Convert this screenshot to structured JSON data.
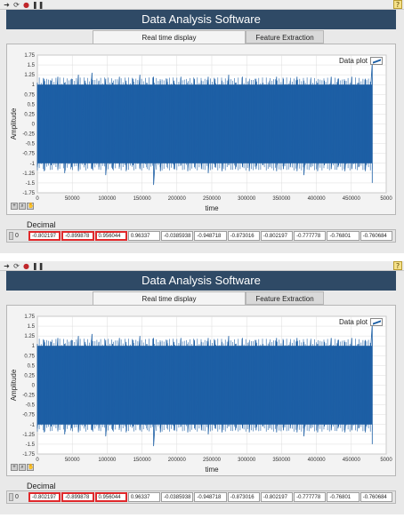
{
  "app_title": "Data Analysis Software",
  "tabs": [
    {
      "label": "Real time display",
      "active": true
    },
    {
      "label": "Feature Extraction",
      "active": false
    }
  ],
  "legend_label": "Data plot",
  "decimal_label": "Decimal",
  "index_value": "0",
  "decimal_values": [
    "-0.802197",
    "-0.899878",
    "0.956044",
    "0.96337",
    "-0.0385938",
    "-0.948718",
    "-0.873016",
    "-0.802197",
    "-0.777778",
    "-0.76801",
    "-0.760684"
  ],
  "highlighted_cells": [
    0,
    1,
    2
  ],
  "toolbar_icons": [
    "run-arrow-icon",
    "run-continuous-icon",
    "abort-icon",
    "pause-icon"
  ],
  "help_icon": "?",
  "colors": {
    "title_bg": "#2f4a66",
    "signal": "#1d5fa5",
    "highlight": "#e0282b",
    "plot_bg": "#ffffff",
    "grid": "#dcdcdc"
  },
  "chart_data": {
    "type": "line",
    "title": "",
    "xlabel": "time",
    "ylabel": "Amplitude",
    "xlim": [
      0,
      500000
    ],
    "ylim": [
      -1.75,
      1.75
    ],
    "x_ticks": [
      "0",
      "50000",
      "100000",
      "150000",
      "200000",
      "250000",
      "300000",
      "350000",
      "400000",
      "450000",
      "5000"
    ],
    "y_ticks": [
      "1.75",
      "1.5",
      "1.25",
      "1",
      "0.75",
      "0.5",
      "0.25",
      "0",
      "-0.25",
      "-0.5",
      "-0.75",
      "-1",
      "-1.25",
      "-1.5",
      "-1.75"
    ],
    "grid": true,
    "legend_position": "top-right",
    "series": [
      {
        "name": "Data plot",
        "x_end": 480000,
        "typical_range": [
          -1.0,
          1.0
        ],
        "envelope_top": [
          1.05,
          1.15,
          1.1,
          1.2,
          1.05,
          1.15,
          1.25,
          1.1,
          1.3,
          1.1,
          1.15,
          1.05,
          1.2,
          1.1,
          1.15,
          1.25,
          1.05,
          1.2,
          1.1,
          1.15,
          1.1,
          1.2,
          1.05,
          1.15,
          1.1,
          1.2,
          1.15,
          1.1,
          1.25,
          1.05,
          1.2,
          1.1,
          1.15,
          1.05,
          1.1,
          1.2,
          1.15,
          1.1,
          1.2,
          1.1,
          1.15,
          1.05,
          1.1,
          1.2,
          1.15,
          1.1,
          1.2,
          1.05,
          1.15,
          1.55
        ],
        "envelope_bottom": [
          -1.1,
          -1.2,
          -1.05,
          -1.15,
          -1.25,
          -1.1,
          -1.2,
          -1.05,
          -1.15,
          -1.1,
          -1.3,
          -1.15,
          -1.1,
          -1.2,
          -1.05,
          -1.15,
          -1.1,
          -1.55,
          -1.2,
          -1.1,
          -1.15,
          -1.05,
          -1.2,
          -1.1,
          -1.15,
          -1.25,
          -1.1,
          -1.2,
          -1.05,
          -1.15,
          -1.1,
          -1.2,
          -1.15,
          -1.05,
          -1.1,
          -1.2,
          -1.15,
          -1.1,
          -1.2,
          -1.3,
          -1.1,
          -1.2,
          -1.05,
          -1.15,
          -1.1,
          -1.2,
          -1.15,
          -1.1,
          -1.2,
          -1.5
        ]
      }
    ]
  }
}
